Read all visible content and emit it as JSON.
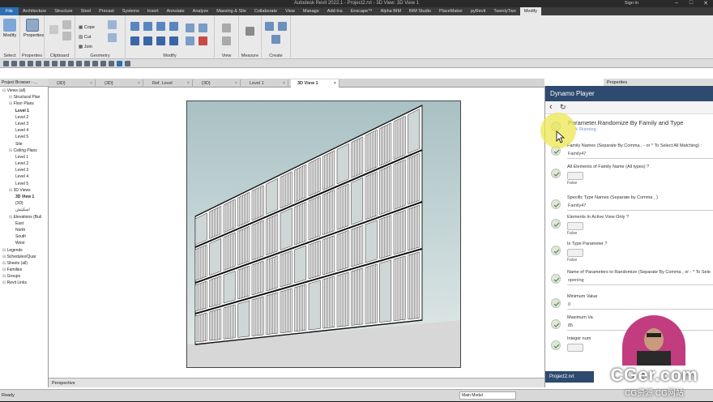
{
  "window": {
    "title": "Autodesk Revit 2022.1 - Project2.rvt - 3D View: 3D View 1",
    "sign_in": "Sign In"
  },
  "menu": {
    "tabs": [
      "File",
      "Architecture",
      "Structure",
      "Steel",
      "Precast",
      "Systems",
      "Insert",
      "Annotate",
      "Analyze",
      "Massing & Site",
      "Collaborate",
      "View",
      "Manage",
      "Add-Ins",
      "Enscape™",
      "Alpha BIM",
      "BIM Studio",
      "PlaceMaker",
      "pyRevit",
      "TwentyTwo",
      "Modify"
    ],
    "active": "Modify"
  },
  "ribbon": {
    "modify_btn": "Modify",
    "properties_btn": "Properties",
    "cope": "Cope",
    "cut": "Cut",
    "join": "Join",
    "groups": [
      "Select",
      "Properties",
      "Clipboard",
      "Geometry",
      "Modify",
      "View",
      "Measure",
      "Create"
    ]
  },
  "project_browser": {
    "header": "Project Browser - ...",
    "tree": [
      {
        "label": "Views (all)",
        "indent": 0,
        "bold": false
      },
      {
        "label": "Structural Plan",
        "indent": 1,
        "bold": false
      },
      {
        "label": "Floor Plans",
        "indent": 1,
        "bold": false
      },
      {
        "label": "Level 1",
        "indent": 2,
        "bold": true
      },
      {
        "label": "Level 2",
        "indent": 2,
        "bold": false
      },
      {
        "label": "Level 3",
        "indent": 2,
        "bold": false
      },
      {
        "label": "Level 4",
        "indent": 2,
        "bold": false
      },
      {
        "label": "Level 5",
        "indent": 2,
        "bold": false
      },
      {
        "label": "Site",
        "indent": 2,
        "bold": false
      },
      {
        "label": "Ceiling Plans",
        "indent": 1,
        "bold": false
      },
      {
        "label": "Level 1",
        "indent": 2,
        "bold": false
      },
      {
        "label": "Level 2",
        "indent": 2,
        "bold": false
      },
      {
        "label": "Level 3",
        "indent": 2,
        "bold": false
      },
      {
        "label": "Level 4",
        "indent": 2,
        "bold": false
      },
      {
        "label": "Level 5",
        "indent": 2,
        "bold": false
      },
      {
        "label": "3D Views",
        "indent": 1,
        "bold": false
      },
      {
        "label": "3D View 1",
        "indent": 2,
        "bold": true
      },
      {
        "label": "{3D}",
        "indent": 2,
        "bold": false
      },
      {
        "label": "اسكيتش",
        "indent": 2,
        "bold": false
      },
      {
        "label": "Elevations (Buil",
        "indent": 1,
        "bold": false
      },
      {
        "label": "East",
        "indent": 2,
        "bold": false
      },
      {
        "label": "North",
        "indent": 2,
        "bold": false
      },
      {
        "label": "South",
        "indent": 2,
        "bold": false
      },
      {
        "label": "West",
        "indent": 2,
        "bold": false
      },
      {
        "label": "Legends",
        "indent": 0,
        "bold": false
      },
      {
        "label": "Schedules/Quar",
        "indent": 0,
        "bold": false
      },
      {
        "label": "Sheets (all)",
        "indent": 0,
        "bold": false
      },
      {
        "label": "Families",
        "indent": 0,
        "bold": false
      },
      {
        "label": "Groups",
        "indent": 0,
        "bold": false
      },
      {
        "label": "Revit Links",
        "indent": 0,
        "bold": false
      }
    ]
  },
  "view_tabs": [
    "{3D}",
    "{3D}",
    "Ref. Level",
    "{3D}",
    "Level 1",
    "3D View 1"
  ],
  "active_view_tab": "3D View 1",
  "properties_panel": "Properties",
  "view_control": {
    "scale": "Perspective"
  },
  "dynamo": {
    "title": "Dynamo Player",
    "script_name": "Parameter.Randomize By Family and Type",
    "status": "Running",
    "fields": [
      {
        "label": "Family Names (Separate By Comma , - or * To Select All Matching) :",
        "type": "text",
        "value": "Family47"
      },
      {
        "label": "All Elements of Family Name (All types) ?",
        "type": "toggle",
        "value": "False"
      },
      {
        "label": "Specific Type Names (Separate by Comma , )",
        "type": "text",
        "value": "Family47"
      },
      {
        "label": "Elements In Active View Only ?",
        "type": "toggle",
        "value": "False"
      },
      {
        "label": "Is Type Parameter ?",
        "type": "toggle",
        "value": "False"
      },
      {
        "label": "Name of Parameters to Randomize (Separate By Comma , or - * To Sele",
        "type": "text",
        "value": "opening"
      },
      {
        "label": "Minimum Value",
        "type": "text",
        "value": "0"
      },
      {
        "label": "Maximum Va",
        "type": "text",
        "value": "85"
      },
      {
        "label": "Integer num",
        "type": "toggle",
        "value": ""
      }
    ],
    "footer": "Project2.rvt"
  },
  "status": {
    "left": "Ready",
    "model": "Main Model"
  },
  "watermark": {
    "big": "CGer.com",
    "small": "CG资源 CG网站"
  },
  "colors": {
    "dynamo_header": "#2e4a6f",
    "file_tab": "#2e6fb4",
    "cursor_highlight": "#ece650"
  }
}
